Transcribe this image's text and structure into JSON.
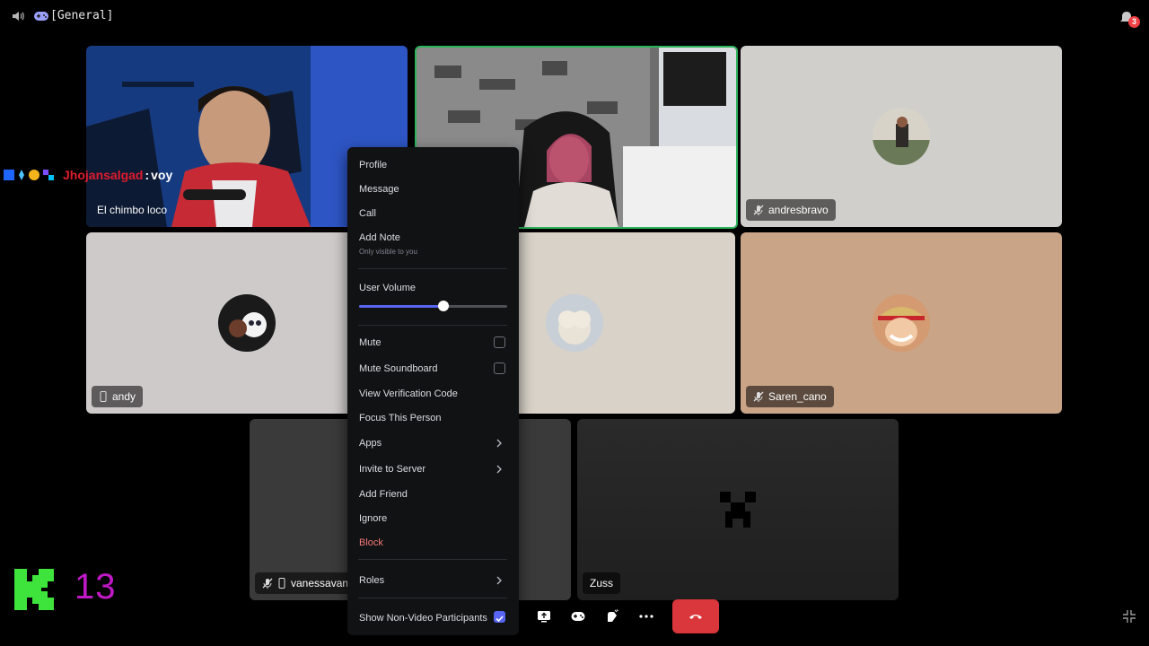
{
  "topbar": {
    "channel": "[General]",
    "notification_count": "3"
  },
  "tiles": [
    {
      "label": "El chimbo loco"
    },
    {
      "label": ""
    },
    {
      "label": "andresbravo",
      "icon": "mic-off-icon"
    },
    {
      "label": "andy",
      "icon": "mobile-icon"
    },
    {
      "label": ""
    },
    {
      "label": "Saren_cano",
      "icon": "mic-off-icon"
    },
    {
      "label": "vanessavand",
      "icon": "mic-off-icon"
    },
    {
      "label": "Zuss"
    }
  ],
  "chat": {
    "username": "Jhojansalgad",
    "separator": ":",
    "message": "voy"
  },
  "context_menu": {
    "profile": "Profile",
    "message": "Message",
    "call": "Call",
    "add_note": "Add Note",
    "add_note_hint": "Only visible to you",
    "user_volume": "User Volume",
    "user_volume_level": 0.57,
    "mute": "Mute",
    "mute_checked": false,
    "mute_soundboard": "Mute Soundboard",
    "mute_soundboard_checked": false,
    "view_verification_code": "View Verification Code",
    "focus_this_person": "Focus This Person",
    "apps": "Apps",
    "invite_to_server": "Invite to Server",
    "add_friend": "Add Friend",
    "ignore": "Ignore",
    "block": "Block",
    "roles": "Roles",
    "show_non_video": "Show Non-Video Participants",
    "show_non_video_checked": true
  },
  "overlay": {
    "number": "13"
  },
  "colors": {
    "accent": "#5865f2",
    "danger": "#da373c",
    "speaking": "#2bb35a",
    "overlay_green": "#3ee33c",
    "overlay_magenta": "#c219c8"
  }
}
